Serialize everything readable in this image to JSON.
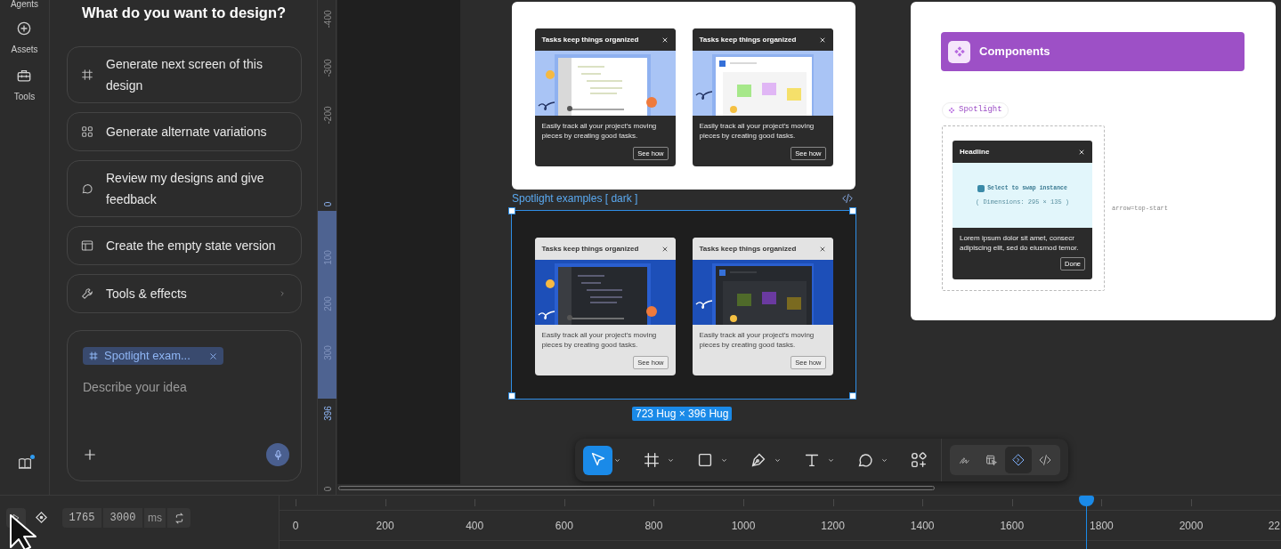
{
  "rail": {
    "items": [
      {
        "label": "Agents",
        "kind": "agents"
      },
      {
        "label": "Assets",
        "kind": "assets"
      },
      {
        "label": "Tools",
        "kind": "tools"
      }
    ],
    "guide_unread": true
  },
  "panel": {
    "title": "What do you want to design?",
    "suggestions": [
      {
        "label": "Generate next screen of this design",
        "kind": "frame",
        "submenu": false
      },
      {
        "label": "Generate alternate variations",
        "kind": "grid",
        "submenu": false
      },
      {
        "label": "Review my designs and give feedback",
        "kind": "chat",
        "submenu": false
      },
      {
        "label": "Create the empty state version",
        "kind": "layout",
        "submenu": false
      },
      {
        "label": "Tools & effects",
        "kind": "wrench",
        "submenu": true
      }
    ],
    "prompt": {
      "chip": "Spotlight exam...",
      "placeholder": "Describe your idea"
    }
  },
  "ruler": {
    "labels": [
      {
        "text": "-400",
        "kind": "plain"
      },
      {
        "text": "-300",
        "kind": "plain"
      },
      {
        "text": "-200",
        "kind": "plain"
      },
      {
        "text": "0",
        "kind": "edge"
      },
      {
        "text": "100",
        "kind": "inside"
      },
      {
        "text": "200",
        "kind": "inside"
      },
      {
        "text": "300",
        "kind": "inside"
      },
      {
        "text": "396",
        "kind": "edge"
      },
      {
        "text": "0",
        "kind": "plain"
      }
    ]
  },
  "canvas": {
    "frames": [
      {
        "kind": "light",
        "selected": false,
        "cards": [
          {
            "title": "Tasks keep things organized",
            "body": "Easily track all your project’s moving pieces by creating good tasks.",
            "button": "See how",
            "kind": "editor"
          },
          {
            "title": "Tasks keep things organized",
            "body": "Easily track all your project’s moving pieces by creating good tasks.",
            "button": "See how",
            "kind": "board"
          }
        ]
      },
      {
        "kind": "dark",
        "label": "Spotlight examples [ dark ]",
        "selected": true,
        "size": "723 Hug × 396 Hug",
        "cards": [
          {
            "title": "Tasks keep things organized",
            "body": "Easily track all your project’s moving pieces by creating good tasks.",
            "button": "See how",
            "kind": "editor"
          },
          {
            "title": "Tasks keep things organized",
            "body": "Easily track all your project’s moving pieces by creating good tasks.",
            "button": "See how",
            "kind": "board"
          }
        ]
      }
    ],
    "components": {
      "header": "Components",
      "tag": "Spotlight",
      "spotlight": {
        "headline": "Headline",
        "slot": "Select to swap instance",
        "dimensions": "( Dimensions: 295 × 135 )",
        "body": "Lorem ipsum dolor sit amet, consecr adipiscing elit, sed do eiusmod temor.",
        "button": "Done"
      },
      "annotation": "arrow=top-start"
    }
  },
  "toolbar": {
    "tools": [
      {
        "kind": "move",
        "selected": true
      },
      {
        "kind": "frame",
        "selected": false
      },
      {
        "kind": "shape",
        "selected": false
      },
      {
        "kind": "pen",
        "selected": false
      },
      {
        "kind": "text",
        "selected": false
      },
      {
        "kind": "comment",
        "selected": false
      },
      {
        "kind": "actions",
        "selected": false
      }
    ],
    "modes": [
      {
        "kind": "draw",
        "selected": false
      },
      {
        "kind": "design",
        "selected": false
      },
      {
        "kind": "dev",
        "selected": true
      },
      {
        "kind": "code",
        "selected": false
      }
    ]
  },
  "timeline": {
    "current": "1765",
    "duration": "3000",
    "unit": "ms",
    "ticks": [
      "0",
      "200",
      "400",
      "600",
      "800",
      "1000",
      "1200",
      "1400",
      "1600",
      "1800",
      "2000",
      "22"
    ]
  }
}
